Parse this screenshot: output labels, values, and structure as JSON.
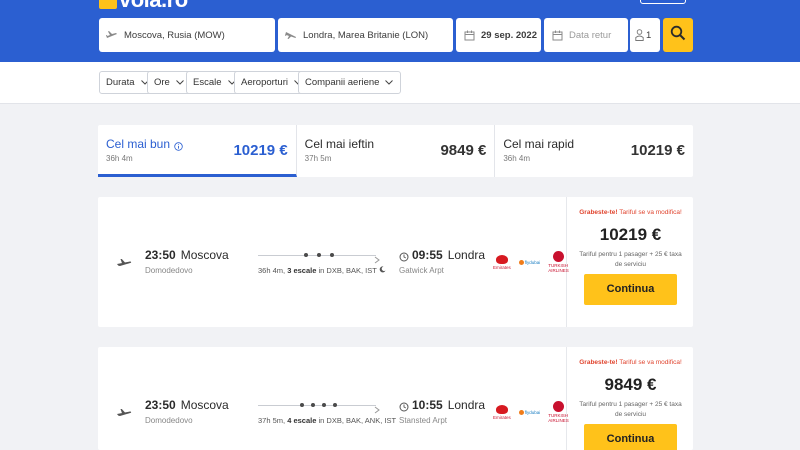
{
  "header": {
    "logo_text": "vola.ro",
    "from_value": "Moscova, Rusia (MOW)",
    "to_value": "Londra, Marea Britanie (LON)",
    "depart_date": "29 sep. 2022",
    "return_placeholder": "Data retur",
    "passengers": "1",
    "accent_color": "#2b5fd1",
    "button_color": "#ffc21a"
  },
  "filters": [
    "Durata",
    "Ore",
    "Escale",
    "Aeroporturi",
    "Companii aeriene"
  ],
  "sort_tabs": [
    {
      "title": "Cel mai bun",
      "duration": "36h 4m",
      "price": "10219 €"
    },
    {
      "title": "Cel mai ieftin",
      "duration": "37h 5m",
      "price": "9849 €"
    },
    {
      "title": "Cel mai rapid",
      "duration": "36h 4m",
      "price": "10219 €"
    }
  ],
  "results": [
    {
      "dep_time": "23:50",
      "dep_city": "Moscova",
      "dep_airport": "Domodedovo",
      "duration": "36h 4m,",
      "stops": "3 escale",
      "via": "in DXB, BAK, IST",
      "arr_time": "09:55",
      "arr_city": "Londra",
      "arr_airport": "Gatwick Arpt",
      "hurry_bold": "Grabeste-te!",
      "hurry_text": "Tariful se va modifica!",
      "price": "10219 €",
      "price_note": "Tariful pentru 1 pasager + 25 € taxa de serviciu",
      "continue_label": "Continua"
    },
    {
      "dep_time": "23:50",
      "dep_city": "Moscova",
      "dep_airport": "Domodedovo",
      "duration": "37h 5m,",
      "stops": "4 escale",
      "via": "in DXB, BAK, ANK, IST",
      "arr_time": "10:55",
      "arr_city": "Londra",
      "arr_airport": "Stansted Arpt",
      "hurry_bold": "Grabeste-te!",
      "hurry_text": "Tariful se va modifica!",
      "price": "9849 €",
      "price_note": "Tariful pentru 1 pasager + 25 € taxa de serviciu",
      "continue_label": "Continua"
    }
  ],
  "airline_logos": {
    "emirates": "Emirates",
    "flydubai": "flydubai",
    "turkish": "TURKISH AIRLINES"
  },
  "icons": [
    "plane-depart-icon",
    "plane-arrive-icon",
    "calendar-icon",
    "person-icon",
    "search-icon",
    "chevron-down-icon",
    "info-icon",
    "moon-icon",
    "clock-icon"
  ]
}
